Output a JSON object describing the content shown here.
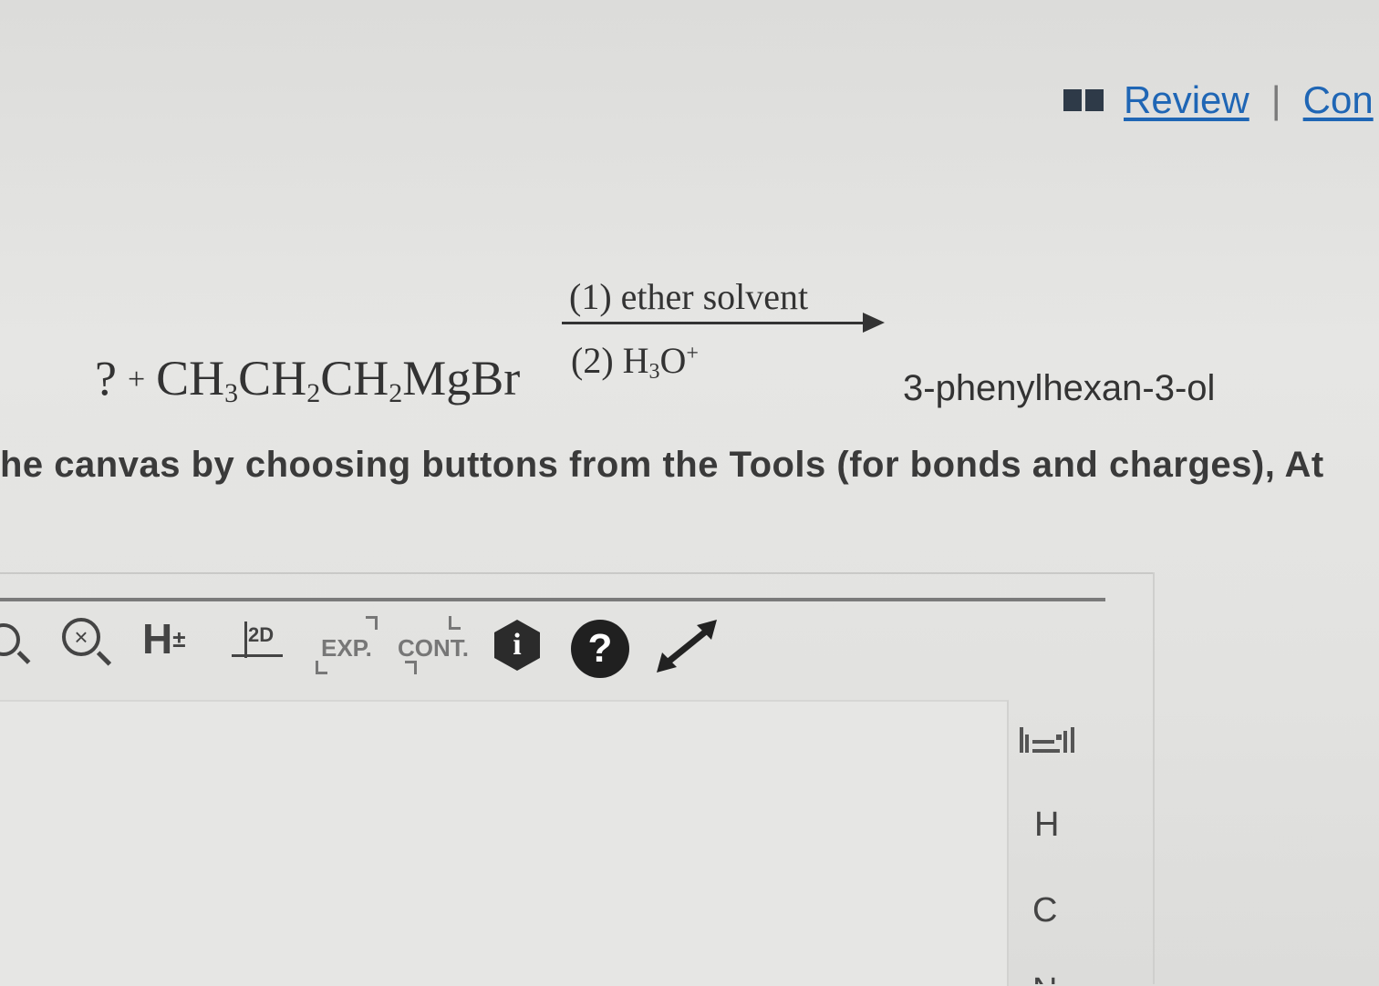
{
  "header": {
    "review_link": "Review",
    "separator": "|",
    "constants_link": "Con"
  },
  "reaction": {
    "unknown": "?",
    "plus": "+",
    "reagent_parts": [
      "CH",
      "3",
      "CH",
      "2",
      "CH",
      "2",
      "MgBr"
    ],
    "condition1": "(1) ether solvent",
    "condition2_parts": [
      "(2) H",
      "3",
      "O",
      "+"
    ],
    "product": "3-phenylhexan-3-ol"
  },
  "instruction": "he canvas by choosing buttons from the Tools (for bonds and charges), At",
  "toolbar": {
    "hcount_label": "H",
    "hcount_sign": "±",
    "t2d_label": "2D",
    "exp_label": "EXP.",
    "cont_label": "CONT.",
    "info_label": "i",
    "help_label": "?"
  },
  "elements": {
    "h": "H",
    "c": "C",
    "n": "N"
  },
  "colors": {
    "link": "#1f66b5",
    "text": "#333333",
    "background": "#e2e2e0"
  }
}
